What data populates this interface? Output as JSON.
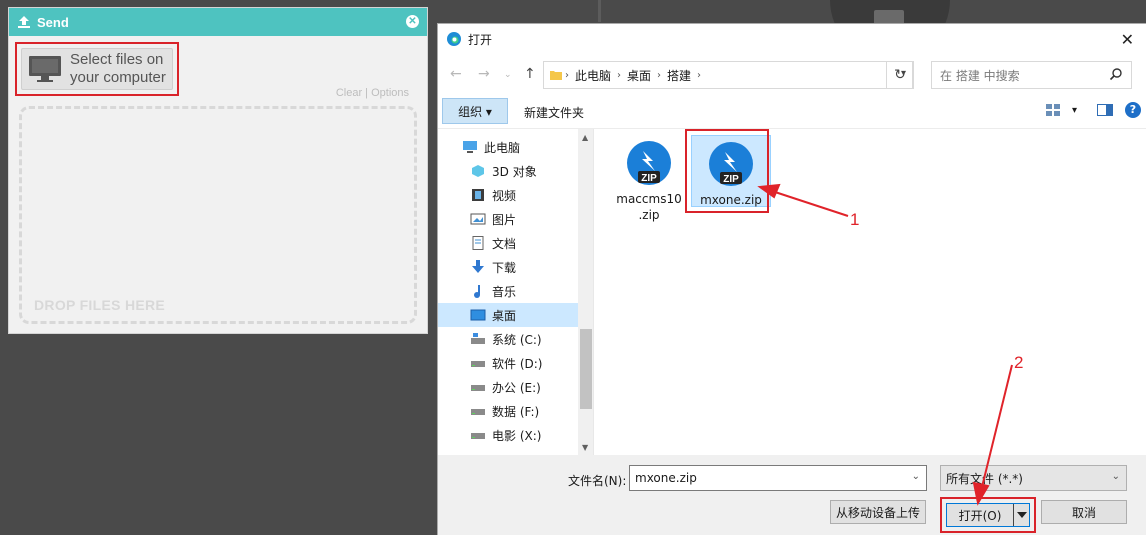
{
  "send_panel": {
    "title": "Send",
    "select_label": "Select files on\nyour computer",
    "clear_options": "Clear | Options",
    "drop_text": "DROP FILES HERE"
  },
  "dialog": {
    "title": "打开",
    "breadcrumb": [
      "此电脑",
      "桌面",
      "搭建"
    ],
    "search_placeholder": "在 搭建 中搜索",
    "organize_label": "组织 ▾",
    "new_folder_label": "新建文件夹",
    "nav_items": [
      {
        "label": "此电脑",
        "icon": "computer-icon"
      },
      {
        "label": "3D 对象",
        "icon": "3d-objects-icon"
      },
      {
        "label": "视频",
        "icon": "video-icon"
      },
      {
        "label": "图片",
        "icon": "pictures-icon"
      },
      {
        "label": "文档",
        "icon": "documents-icon"
      },
      {
        "label": "下载",
        "icon": "download-icon"
      },
      {
        "label": "音乐",
        "icon": "music-icon"
      },
      {
        "label": "桌面",
        "icon": "desktop-icon"
      },
      {
        "label": "系统 (C:)",
        "icon": "drive-icon"
      },
      {
        "label": "软件 (D:)",
        "icon": "drive-icon"
      },
      {
        "label": "办公 (E:)",
        "icon": "drive-icon"
      },
      {
        "label": "数据 (F:)",
        "icon": "drive-icon"
      },
      {
        "label": "电影 (X:)",
        "icon": "drive-icon"
      }
    ],
    "files": [
      {
        "name": "maccms10\n.zip",
        "badge": "ZIP"
      },
      {
        "name": "mxone.zip",
        "badge": "ZIP"
      }
    ],
    "filename_label": "文件名(N):",
    "filename_value": "mxone.zip",
    "filetype_value": "所有文件 (*.*)",
    "upload_mobile_label": "从移动设备上传",
    "open_label": "打开(O)",
    "cancel_label": "取消"
  },
  "annotations": {
    "marker_1": "1",
    "marker_2": "2",
    "color": "#e0232a"
  }
}
